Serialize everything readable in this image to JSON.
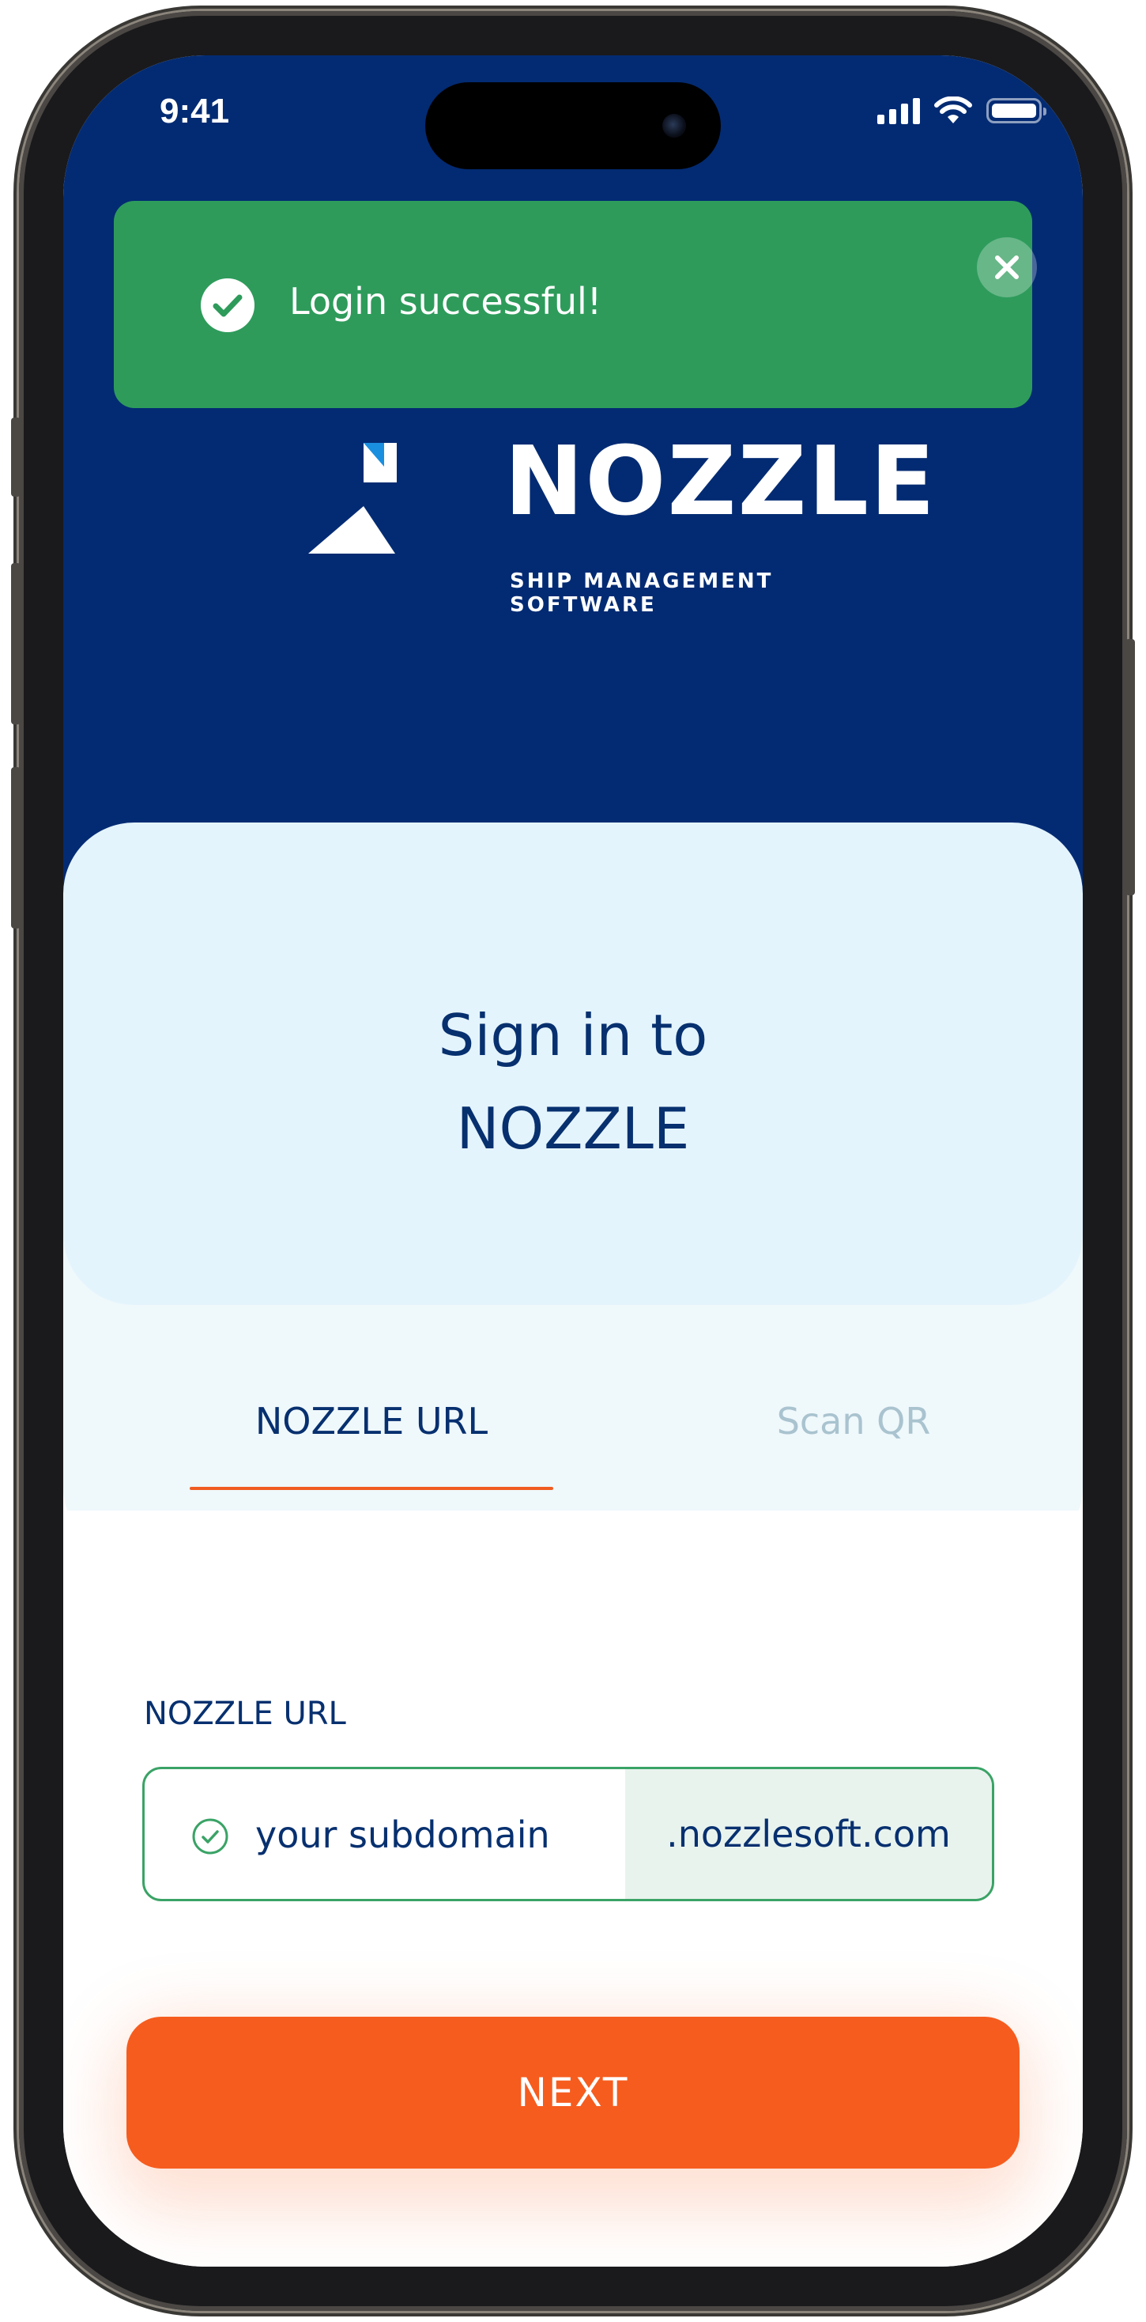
{
  "status_bar": {
    "time": "9:41"
  },
  "toast": {
    "message": "Login successful!"
  },
  "logo": {
    "name": "NOZZLE",
    "tagline": "SHIP MANAGEMENT SOFTWARE"
  },
  "signin": {
    "title_line1": "Sign in to",
    "title_line2": "NOZZLE"
  },
  "tabs": [
    {
      "label": "NOZZLE URL",
      "active": true
    },
    {
      "label": "Scan QR",
      "active": false
    }
  ],
  "url_field": {
    "label": "NOZZLE URL",
    "placeholder": "your subdomain",
    "suffix": ".nozzlesoft.com"
  },
  "next_button": {
    "label": "NEXT"
  },
  "colors": {
    "header_navy": "#032b73",
    "text_navy": "#07306f",
    "success_green": "#2e9b5b",
    "accent_orange": "#f65c1e",
    "card_light_blue": "#e4f4fc",
    "tab_inactive": "#a9c3cf",
    "logo_accent_blue": "#1a8fe0"
  }
}
